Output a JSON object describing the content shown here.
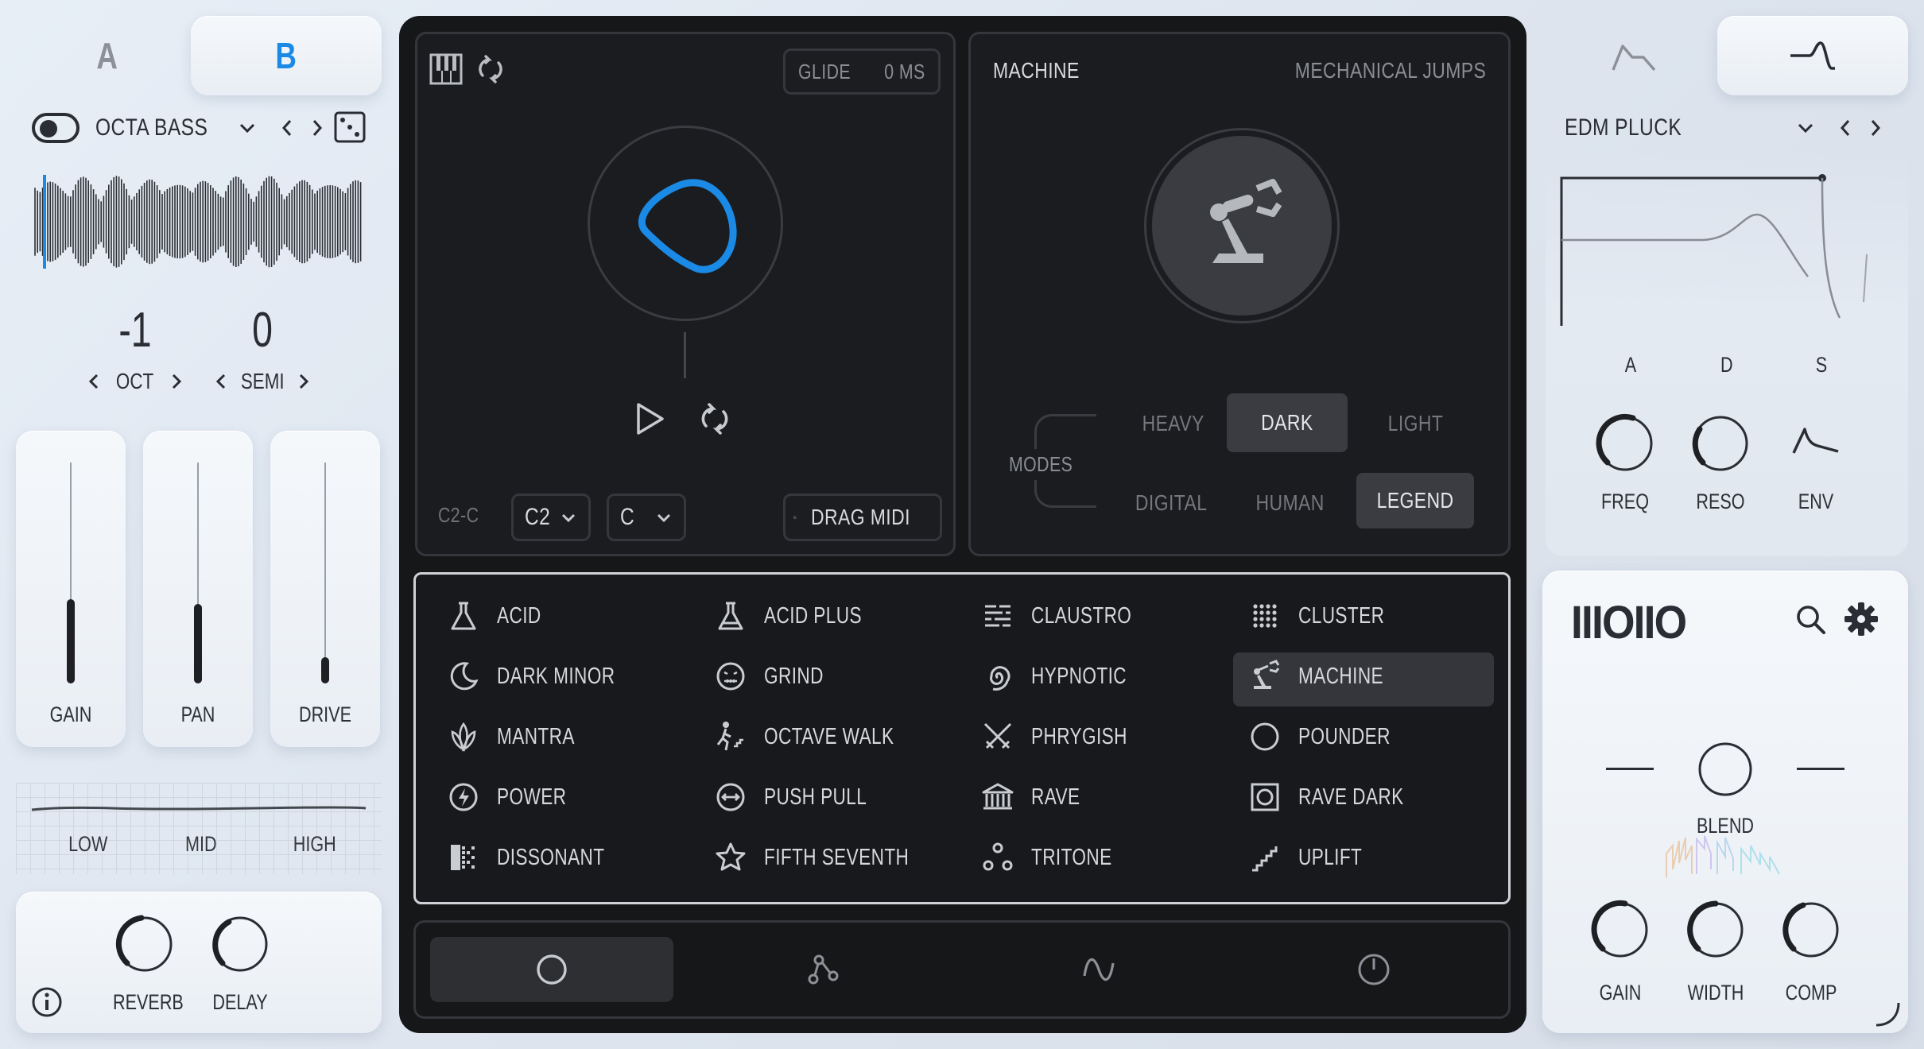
{
  "tabs_ab": {
    "a": "A",
    "b": "B",
    "active": "B"
  },
  "left": {
    "preset_name": "OCTA BASS",
    "oct_value": "-1",
    "oct_label": "OCT",
    "semi_value": "0",
    "semi_label": "SEMI",
    "faders": [
      {
        "label": "GAIN",
        "level": 0.38
      },
      {
        "label": "PAN",
        "level": 0.36
      },
      {
        "label": "DRIVE",
        "level": 0.12
      }
    ],
    "eq": {
      "low": "LOW",
      "mid": "MID",
      "high": "HIGH"
    },
    "fx": [
      {
        "label": "REVERB"
      },
      {
        "label": "DELAY"
      }
    ]
  },
  "sequencer": {
    "glide_label": "GLIDE",
    "glide_value": "0 MS",
    "range_label": "C2-C",
    "octave_select": "C2",
    "key_select": "C",
    "drag_midi_label": "DRAG MIDI"
  },
  "machine_panel": {
    "title": "MACHINE",
    "subtitle": "MECHANICAL JUMPS",
    "modes_label": "MODES",
    "modes": [
      {
        "label": "HEAVY",
        "active": false
      },
      {
        "label": "DARK",
        "active": true
      },
      {
        "label": "LIGHT",
        "active": false
      },
      {
        "label": "DIGITAL",
        "active": false
      },
      {
        "label": "HUMAN",
        "active": false
      },
      {
        "label": "LEGEND",
        "active": true
      }
    ]
  },
  "patterns": [
    {
      "label": "ACID",
      "icon": "flask-icon"
    },
    {
      "label": "ACID PLUS",
      "icon": "flask-plus-icon"
    },
    {
      "label": "CLAUSTRO",
      "icon": "bars-icon"
    },
    {
      "label": "CLUSTER",
      "icon": "dot-grid-icon"
    },
    {
      "label": "DARK MINOR",
      "icon": "moon-icon"
    },
    {
      "label": "GRIND",
      "icon": "grimace-icon"
    },
    {
      "label": "HYPNOTIC",
      "icon": "spiral-icon"
    },
    {
      "label": "MACHINE",
      "icon": "robot-arm-icon",
      "selected": true
    },
    {
      "label": "MANTRA",
      "icon": "lotus-icon"
    },
    {
      "label": "OCTAVE WALK",
      "icon": "walker-icon"
    },
    {
      "label": "PHRYGISH",
      "icon": "swords-icon"
    },
    {
      "label": "POUNDER",
      "icon": "circle-icon"
    },
    {
      "label": "POWER",
      "icon": "bolt-icon"
    },
    {
      "label": "PUSH PULL",
      "icon": "arrows-icon"
    },
    {
      "label": "RAVE",
      "icon": "temple-icon"
    },
    {
      "label": "RAVE DARK",
      "icon": "target-square-icon"
    },
    {
      "label": "DISSONANT",
      "icon": "dither-icon"
    },
    {
      "label": "FIFTH SEVENTH",
      "icon": "star-icon"
    },
    {
      "label": "TRITONE",
      "icon": "nodes-icon"
    },
    {
      "label": "UPLIFT",
      "icon": "stairs-icon"
    }
  ],
  "right": {
    "preset_name": "EDM PLUCK",
    "adsr": {
      "a": "A",
      "d": "D",
      "s": "S"
    },
    "filter_knobs": [
      {
        "label": "FREQ"
      },
      {
        "label": "RESO"
      },
      {
        "label": "ENV"
      }
    ],
    "logo": "IIIOIIO",
    "blend_label": "BLEND",
    "out_knobs": [
      {
        "label": "GAIN"
      },
      {
        "label": "WIDTH"
      },
      {
        "label": "COMP"
      }
    ]
  },
  "colors": {
    "accent": "#1a8ae6",
    "dark_bg": "#161719",
    "light_bg": "#e6edf5"
  }
}
